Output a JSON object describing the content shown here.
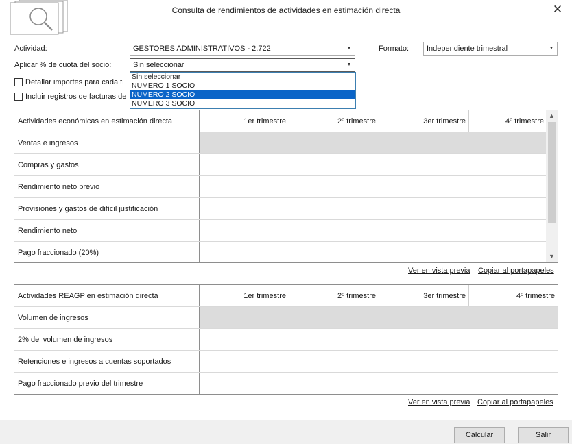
{
  "window": {
    "title": "Consulta de rendimientos de actividades en estimación directa",
    "close_glyph": "✕"
  },
  "form": {
    "actividad_label": "Actividad:",
    "actividad_value": "GESTORES ADMINISTRATIVOS - 2.722",
    "formato_label": "Formato:",
    "formato_value": "Independiente trimestral",
    "aplicar_label": "Aplicar % de cuota del socio:",
    "aplicar_value": "Sin seleccionar",
    "detallar_label": "Detallar importes para cada ti",
    "incluir_label": "Incluir registros de facturas de",
    "combo_arrow": "▼"
  },
  "dropdown": {
    "options": [
      "Sin seleccionar",
      "NUMERO 1 SOCIO",
      "NUMERO 2 SOCIO",
      "NUMERO 3 SOCIO"
    ],
    "selected_index": 2
  },
  "table1": {
    "headers": [
      "Actividades económicas en estimación directa",
      "1er trimestre",
      "2º trimestre",
      "3er trimestre",
      "4º trimestre"
    ],
    "rows": [
      "Ventas e ingresos",
      "Compras y gastos",
      "Rendimiento neto previo",
      "Provisiones y gastos de difícil justificación",
      "Rendimiento neto",
      "Pago fraccionado (20%)"
    ],
    "scroll_up": "▲",
    "scroll_down": "▼"
  },
  "links1": {
    "preview": "Ver en vista previa",
    "copy": "Copiar al portapapeles"
  },
  "table2": {
    "headers": [
      "Actividades REAGP en estimación directa",
      "1er trimestre",
      "2º trimestre",
      "3er trimestre",
      "4º trimestre"
    ],
    "rows": [
      "Volumen de ingresos",
      "2% del volumen de ingresos",
      "Retenciones e ingresos a cuentas soportados",
      "Pago fraccionado previo del trimestre"
    ]
  },
  "links2": {
    "preview": "Ver en vista previa",
    "copy": "Copiar al portapapeles"
  },
  "buttons": {
    "calcular": "Calcular",
    "salir": "Salir"
  },
  "colors": {
    "selection": "#0a64c8",
    "grid_border": "#8e8e8e",
    "shaded_row": "#dcdcdc",
    "footer": "#f0f0f0"
  },
  "icons": {
    "window_icon": "documents-search-icon"
  }
}
